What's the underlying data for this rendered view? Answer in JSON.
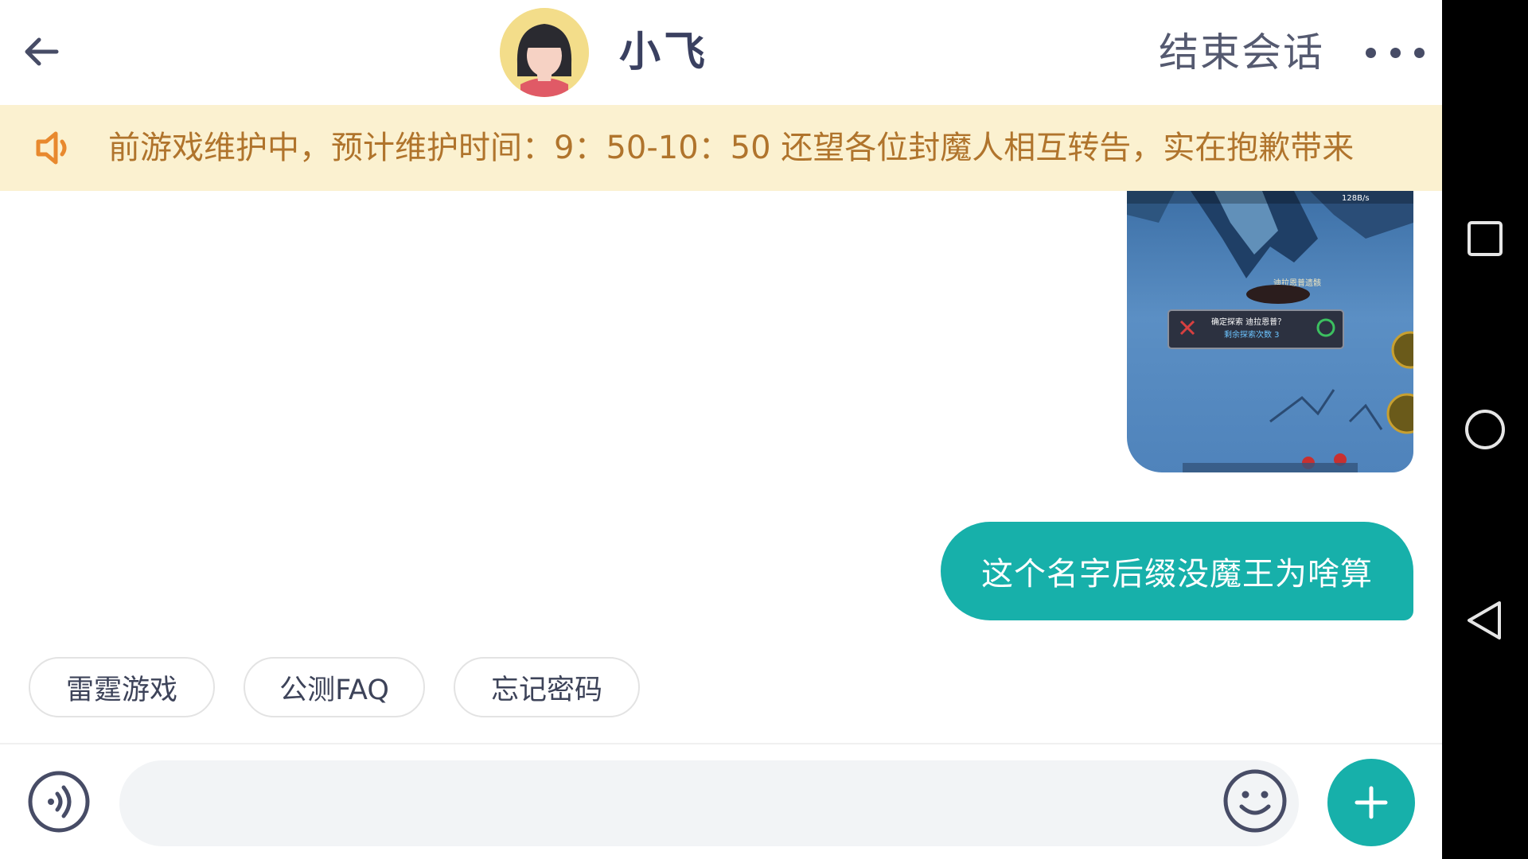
{
  "header": {
    "title": "小飞",
    "end_session_label": "结束会话",
    "back_icon": "arrow-left-icon",
    "more_icon": "more-dots-icon"
  },
  "notice": {
    "icon": "speaker-icon",
    "text": "前游戏维护中，预计维护时间：9：50-10：50 还望各位封魔人相互转告，实在抱歉带来"
  },
  "messages": [
    {
      "type": "image",
      "from": "self",
      "image_texts": {
        "status": "128B/s",
        "npc_label": "迪拉恩普遗骸",
        "dialog_line1": "确定探索 迪拉恩普？",
        "dialog_line2": "剩余探索次数 3"
      }
    },
    {
      "type": "text",
      "from": "self",
      "text": "这个名字后缀没魔王为啥算"
    }
  ],
  "quick_replies": [
    {
      "label": "雷霆游戏"
    },
    {
      "label": "公测FAQ"
    },
    {
      "label": "忘记密码"
    }
  ],
  "input": {
    "value": "",
    "placeholder": ""
  },
  "colors": {
    "accent": "#17b0aa",
    "notice_bg": "#fbf1d0",
    "notice_text": "#b0742c",
    "title_text": "#3a4060"
  }
}
